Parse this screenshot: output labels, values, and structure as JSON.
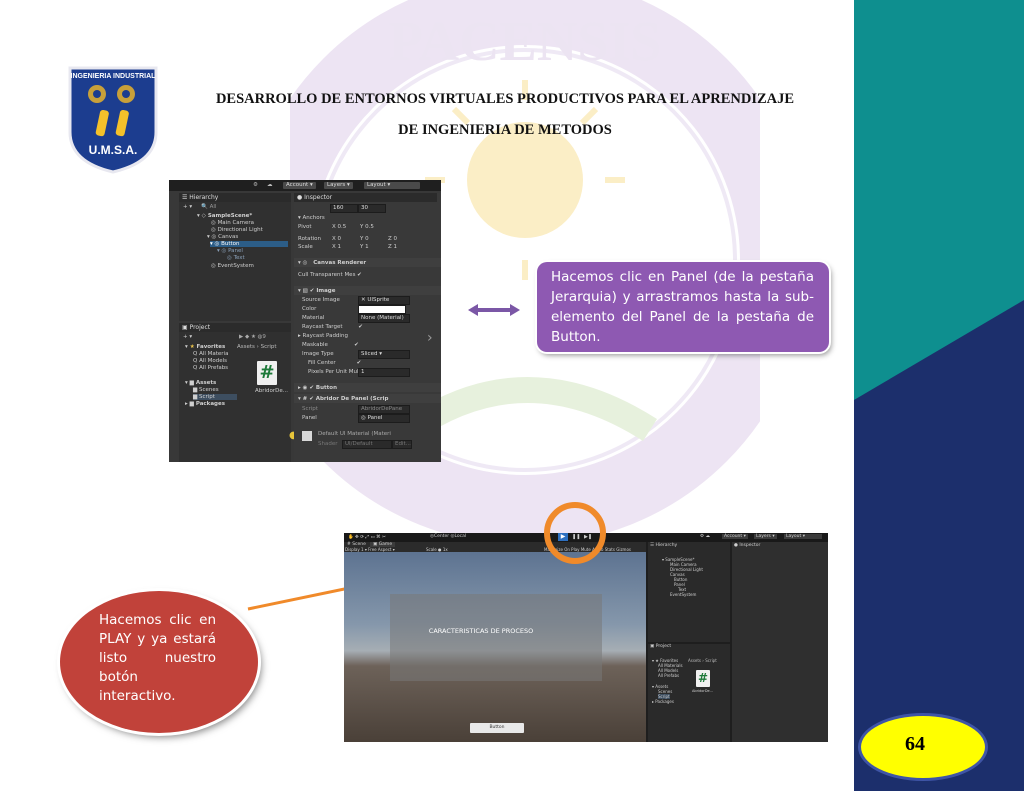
{
  "header": {
    "logo_text_top": "INGENIERIA INDUSTRIAL",
    "logo_text_bottom": "U.M.S.A.",
    "title_line1": "DESARROLLO DE ENTORNOS VIRTUALES PRODUCTIVOS PARA EL APRENDIZAJE",
    "title_line2": "DE INGENIERIA DE METODOS"
  },
  "watermark": {
    "text": "JOR PACENSIS D ANDRE",
    "colors": {
      "ring": "#ede4f3",
      "sun": "#fbeec6"
    }
  },
  "unity_editor_1": {
    "toolbar": {
      "account": "Account",
      "layers": "Layers",
      "layout": "Layout"
    },
    "hierarchy": {
      "tab": "Hierarchy",
      "search": "All",
      "items": [
        "SampleScene*",
        "Main Camera",
        "Directional Light",
        "Canvas",
        "Button",
        "Panel",
        "Text",
        "EventSystem"
      ]
    },
    "project": {
      "tab": "Project",
      "favorites": "Favorites",
      "favorites_items": [
        "All Materia",
        "All Models",
        "All Prefabs"
      ],
      "assets": "Assets",
      "assets_items": [
        "Scenes",
        "Script"
      ],
      "packages": "Packages",
      "breadcrumb_assets": "Assets",
      "breadcrumb_script": "Script",
      "file_name": "AbridorDe..."
    },
    "inspector": {
      "tab": "Inspector",
      "width": "160",
      "height": "30",
      "anchors": "Anchors",
      "pivot": "Pivot",
      "pivot_x": "0.5",
      "pivot_y": "0.5",
      "rotation": "Rotation",
      "rot_x": "0",
      "rot_y": "0",
      "rot_z": "0",
      "scale": "Scale",
      "scale_x": "1",
      "scale_y": "1",
      "scale_z": "1",
      "canvas_renderer": "Canvas Renderer",
      "cull_label": "Cull Transparent Mes",
      "image_component": "Image",
      "source_image": "Source Image",
      "source_image_value": "UISprite",
      "color": "Color",
      "material": "Material",
      "material_value": "None (Material)",
      "raycast_target": "Raycast Target",
      "raycast_padding": "Raycast Padding",
      "maskable": "Maskable",
      "image_type": "Image Type",
      "image_type_value": "Sliced",
      "fill_center": "Fill Center",
      "pixels_per_unit": "Pixels Per Unit Mul",
      "pixels_per_unit_value": "1",
      "button_component": "Button",
      "script_component": "Abridor De Panel (Scrip",
      "script_label": "Script",
      "script_value": "AbridorDePane",
      "panel_label": "Panel",
      "panel_value": "Panel",
      "default_material": "Default UI Material (Materi",
      "shader_label": "Shader",
      "shader_value": "UI/Default",
      "edit_label": "Edit..."
    }
  },
  "callout_1": {
    "text": "Hacemos clic en Panel (de la pestaña Jerarquia) y arrastramos hasta la sub-elemento del Panel de la pestaña de Button.",
    "color": "#8e59b2"
  },
  "callout_2": {
    "text": "Hacemos clic en PLAY y ya estará listo nuestro botón interactivo.",
    "color": "#c1423a"
  },
  "unity_editor_2": {
    "toolbar": {
      "account": "Account",
      "layers": "Layers",
      "layout": "Layout",
      "center": "Center",
      "local": "Local"
    },
    "tabs": {
      "scene": "Scene",
      "game": "Game",
      "hierarchy": "Hierarchy",
      "inspector": "Inspector",
      "project": "Project"
    },
    "game_bar": {
      "display": "Display 1",
      "aspect": "Free Aspect",
      "scale": "Scale",
      "scale_value": "1x",
      "maximize": "Maximize On Play",
      "mute": "Mute Audio",
      "stats": "Stats",
      "gizmos": "Gizmos"
    },
    "panel_text": "CARACTERISTICAS DE PROCESO",
    "button_text": "Button",
    "hierarchy_items": [
      "SampleScene*",
      "Main Camera",
      "Directional Light",
      "Canvas",
      "Button",
      "Panel",
      "Text",
      "EventSystem"
    ],
    "project_items": [
      "Favorites",
      "All Materials",
      "All Models",
      "All Prefabs",
      "Assets",
      "Scenes",
      "Script",
      "Packages"
    ],
    "breadcrumb_assets": "Assets",
    "breadcrumb_script": "Script",
    "file_name": "AbridorDe..."
  },
  "page_number": "64",
  "colors": {
    "teal_band": "#0e8f8f",
    "navy_band": "#1c2f6c",
    "badge": "#ffff00",
    "badge_border": "#3f55a6",
    "arrow_purple": "#7b57a6",
    "arrow_orange": "#f08a2a"
  }
}
